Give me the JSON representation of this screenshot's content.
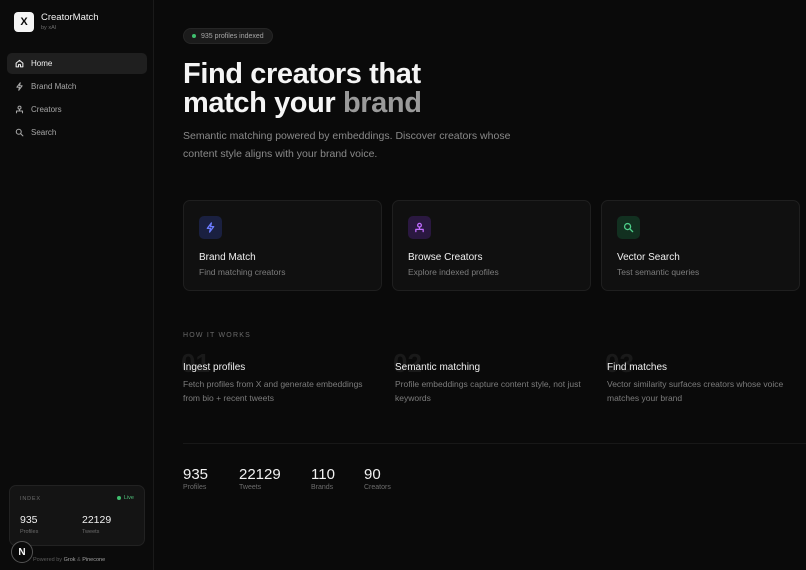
{
  "app": {
    "logo_letter": "X",
    "name": "CreatorMatch",
    "subtitle": "by xAI"
  },
  "sidebar": {
    "items": [
      {
        "label": "Home",
        "icon": "home-icon",
        "active": true
      },
      {
        "label": "Brand Match",
        "icon": "lightning-icon",
        "active": false
      },
      {
        "label": "Creators",
        "icon": "users-icon",
        "active": false
      },
      {
        "label": "Search",
        "icon": "search-icon",
        "active": false
      }
    ],
    "index": {
      "title": "INDEX",
      "status": "Live",
      "profiles_value": "935",
      "profiles_label": "Profiles",
      "tweets_value": "22129",
      "tweets_label": "Tweets"
    },
    "avatar_letter": "N",
    "powered": {
      "prefix": "Powered by",
      "first": "Grok",
      "amp": "&",
      "second": "Pinecone"
    }
  },
  "main": {
    "pill": "935 profiles indexed",
    "hero_line1": "Find creators that",
    "hero_line2_a": "match your ",
    "hero_line2_b": "brand",
    "subtitle": "Semantic matching powered by embeddings. Discover creators whose content style aligns with your brand voice.",
    "cards": [
      {
        "title": "Brand Match",
        "desc": "Find matching creators",
        "icon": "lightning-icon",
        "accent": "#6b7cff",
        "bg": "#1a2040"
      },
      {
        "title": "Browse Creators",
        "desc": "Explore indexed profiles",
        "icon": "users-icon",
        "accent": "#c06cff",
        "bg": "#2a1840"
      },
      {
        "title": "Vector Search",
        "desc": "Test semantic queries",
        "icon": "search-icon",
        "accent": "#4fcf8a",
        "bg": "#123020"
      }
    ],
    "how_label": "HOW IT WORKS",
    "steps": [
      {
        "num": "01",
        "title": "Ingest profiles",
        "desc": "Fetch profiles from X and generate embeddings from bio + recent tweets"
      },
      {
        "num": "02",
        "title": "Semantic matching",
        "desc": "Profile embeddings capture content style, not just keywords"
      },
      {
        "num": "03",
        "title": "Find matches",
        "desc": "Vector similarity surfaces creators whose voice matches your brand"
      }
    ],
    "stats": [
      {
        "value": "935",
        "label": "Profiles"
      },
      {
        "value": "22129",
        "label": "Tweets"
      },
      {
        "value": "110",
        "label": "Brands"
      },
      {
        "value": "90",
        "label": "Creators"
      }
    ]
  }
}
